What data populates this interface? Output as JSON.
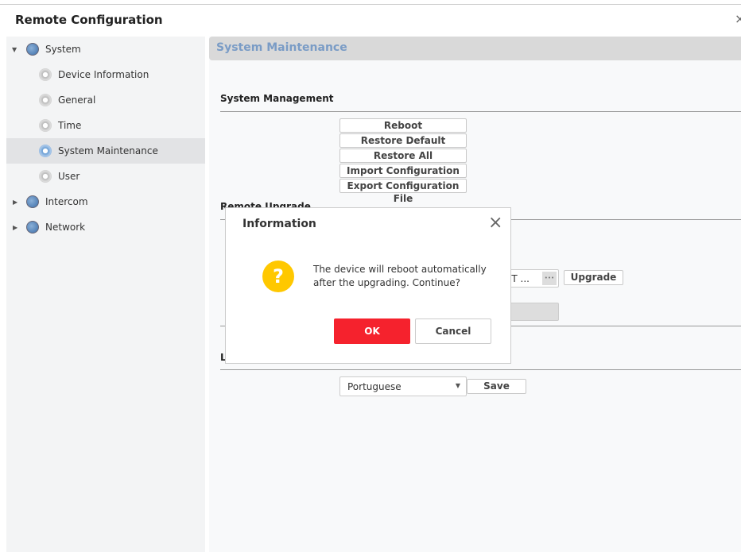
{
  "window": {
    "title": "Remote Configuration",
    "close": "×"
  },
  "sidebar": {
    "items": [
      {
        "label": "System",
        "icon": "globe-gear-icon",
        "expanded": true
      },
      {
        "label": "Device Information",
        "icon": "gear-icon"
      },
      {
        "label": "General",
        "icon": "gear-icon"
      },
      {
        "label": "Time",
        "icon": "gear-icon"
      },
      {
        "label": "System Maintenance",
        "icon": "gear-icon",
        "selected": true
      },
      {
        "label": "User",
        "icon": "gear-icon"
      },
      {
        "label": "Intercom",
        "icon": "globe-gear-icon",
        "expanded": false
      },
      {
        "label": "Network",
        "icon": "globe-gear-icon",
        "expanded": false
      }
    ]
  },
  "main": {
    "header": "System Maintenance",
    "system_management": {
      "title": "System Management",
      "buttons": [
        "Reboot",
        "Restore Default Settings",
        "Restore All",
        "Import Configuration File",
        "Export Configuration File"
      ]
    },
    "remote_upgrade": {
      "title": "Remote Upgrade",
      "file_value": "CT ...",
      "browse": "•••",
      "upgrade": "Upgrade"
    },
    "language": {
      "title": "L",
      "selected": "Portuguese",
      "save": "Save"
    }
  },
  "dialog": {
    "title": "Information",
    "message_line1": "The device will reboot automatically",
    "message_line2": "after the upgrading. Continue?",
    "icon": "question-icon",
    "ok": "OK",
    "cancel": "Cancel",
    "close": "×",
    "accent": "#f5222d",
    "icon_color": "#ffc800"
  }
}
